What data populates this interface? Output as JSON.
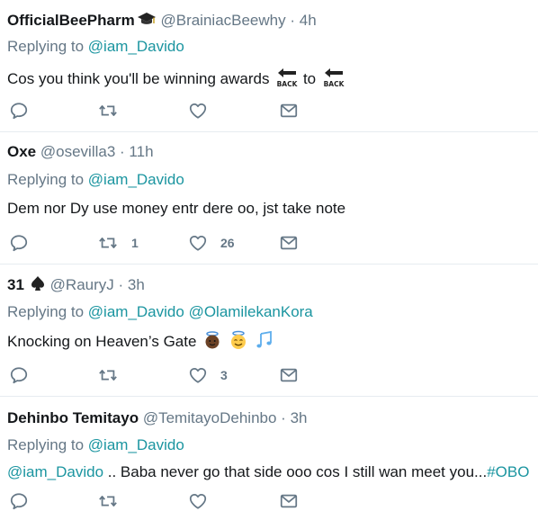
{
  "tweets": [
    {
      "name": "OfficialBeePharm",
      "name_badge_icon": "graduation-cap-icon",
      "handle": "@BrainiacBeewhy",
      "sep": "·",
      "time": "4h",
      "replying_prefix": "Replying to",
      "mentions": [
        "@iam_Davido"
      ],
      "text": "Cos you think you'll be winning awards",
      "text_mid": "to",
      "text_emojis": [
        "back-arrow-icon",
        "back-arrow-icon"
      ],
      "back_label": "BACK",
      "actions": {
        "reply": "",
        "retweet": "",
        "like": "",
        "dm": ""
      }
    },
    {
      "name": "Oxe",
      "handle": "@osevilla3",
      "sep": "·",
      "time": "11h",
      "replying_prefix": "Replying to",
      "mentions": [
        "@iam_Davido"
      ],
      "text": "Dem nor Dy use money entr dere oo, jst take note",
      "actions": {
        "reply": "",
        "retweet": "1",
        "like": "26",
        "dm": ""
      }
    },
    {
      "name": "31",
      "name_badge_icon": "spade-icon",
      "handle": "@RauryJ",
      "sep": "·",
      "time": "3h",
      "replying_prefix": "Replying to",
      "mentions": [
        "@iam_Davido",
        "@OlamilekanKora"
      ],
      "text": "Knocking on Heaven’s Gate",
      "text_emojis": [
        "angel-dark-icon",
        "smiling-halo-icon",
        "music-notes-icon"
      ],
      "actions": {
        "reply": "",
        "retweet": "",
        "like": "3",
        "dm": ""
      }
    },
    {
      "name": "Dehinbo Temitayo",
      "handle": "@TemitayoDehinbo",
      "sep": "·",
      "time": "3h",
      "replying_prefix": "Replying to",
      "mentions": [
        "@iam_Davido"
      ],
      "text_mention": "@iam_Davido",
      "text": " .. Baba never go that side ooo cos I still wan meet you...",
      "text_hashtag": "#OBO",
      "actions": {
        "reply": "",
        "retweet": "",
        "like": "",
        "dm": ""
      }
    }
  ],
  "colors": {
    "name": "#14171a",
    "secondary": "#657786",
    "link": "#1b95a0",
    "divider": "#e6ecf0"
  }
}
